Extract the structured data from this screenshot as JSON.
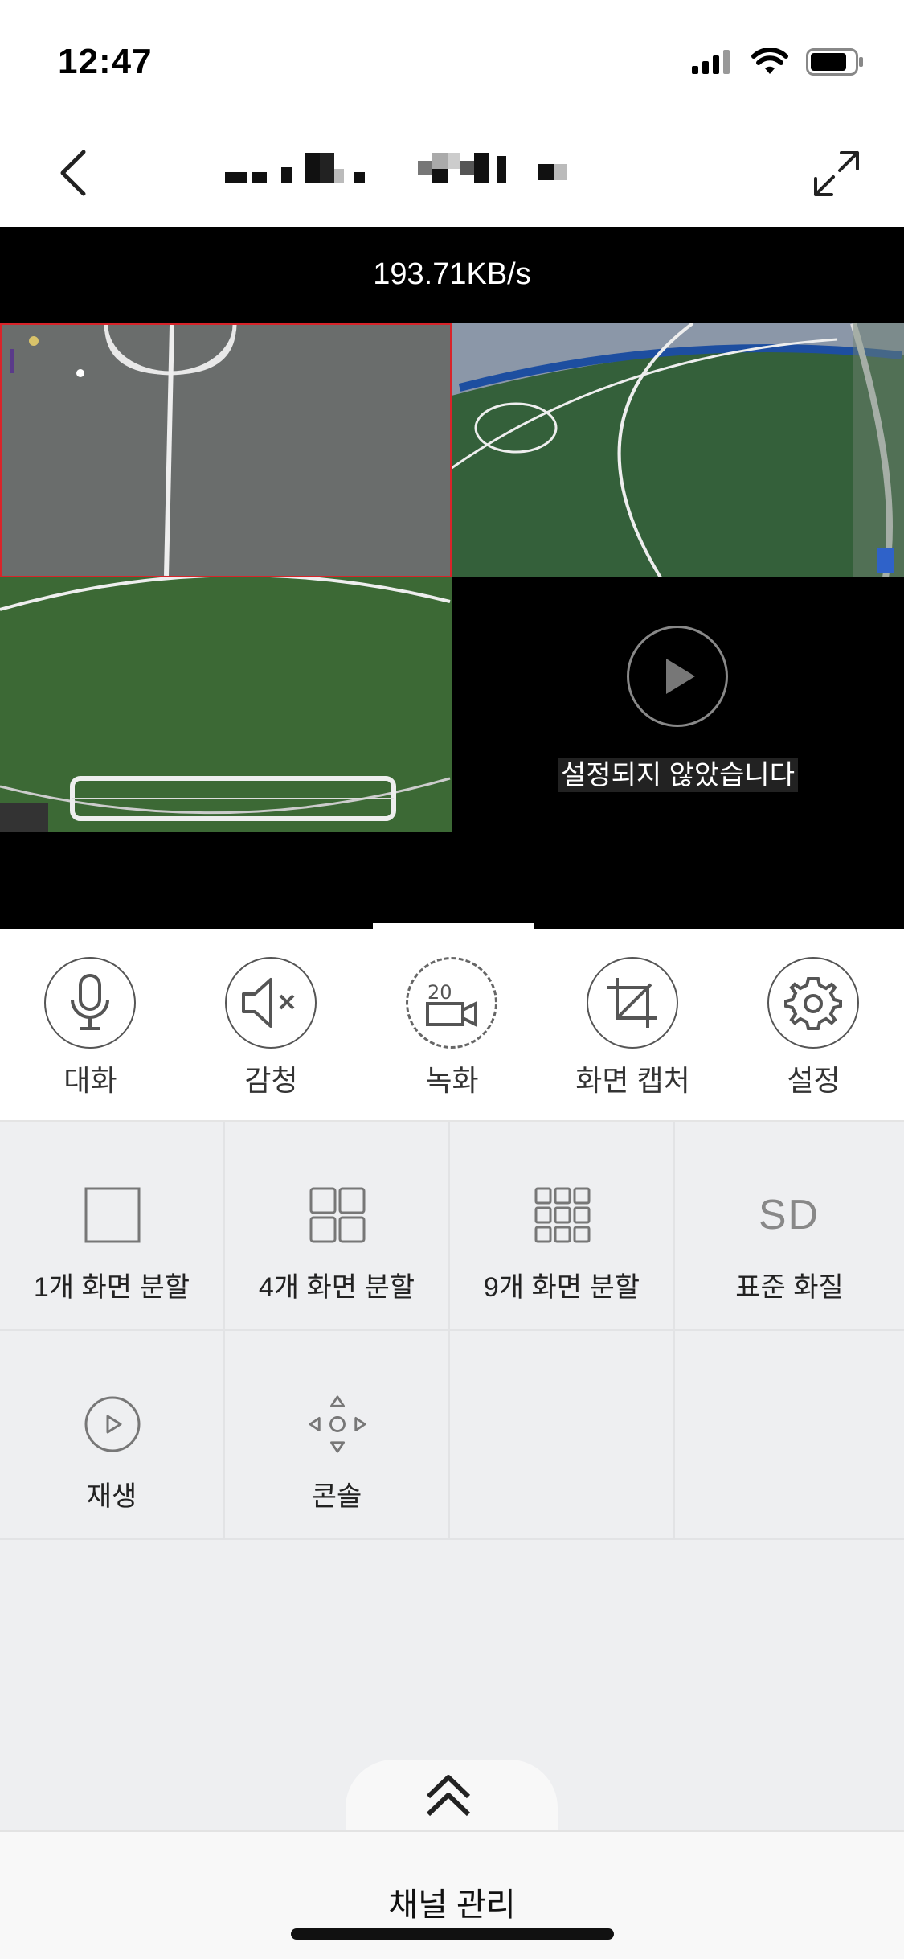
{
  "status": {
    "time": "12:47"
  },
  "nav": {
    "title": ""
  },
  "video": {
    "bitrate": "193.71KB/s",
    "empty_tile_message": "설정되지 않았습니다"
  },
  "tools": [
    {
      "label": "대화",
      "icon": "microphone-icon"
    },
    {
      "label": "감청",
      "icon": "speaker-mute-icon"
    },
    {
      "label": "녹화",
      "icon": "record-icon"
    },
    {
      "label": "화면 캡처",
      "icon": "crop-icon"
    },
    {
      "label": "설정",
      "icon": "gear-icon"
    }
  ],
  "grid": [
    {
      "label": "1개 화면 분할",
      "icon": "single-split-icon"
    },
    {
      "label": "4개 화면 분할",
      "icon": "four-split-icon"
    },
    {
      "label": "9개 화면 분할",
      "icon": "nine-split-icon"
    },
    {
      "label": "표준 화질",
      "icon": "sd-quality-icon",
      "icon_text": "SD"
    },
    {
      "label": "재생",
      "icon": "play-icon"
    },
    {
      "label": "콘솔",
      "icon": "dpad-icon"
    }
  ],
  "bottom": {
    "label": "채널 관리"
  },
  "colors": {
    "selected_tile_border": "#d8242a",
    "grid_bg": "#eeeff1"
  }
}
